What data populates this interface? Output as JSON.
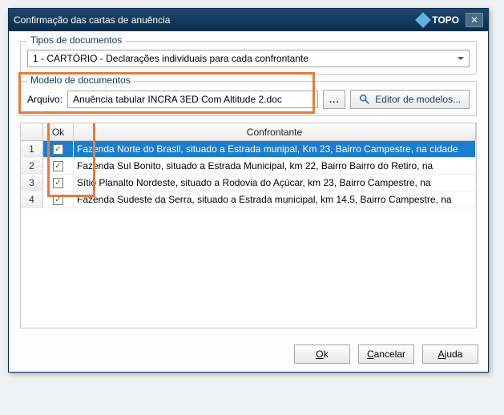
{
  "titlebar": {
    "title": "Confirmação das cartas de anuência",
    "logo": "TOPO",
    "close": "✕"
  },
  "tipos": {
    "legend": "Tipos de documentos",
    "selected": "1 - CARTÓRIO - Declarações individuais para cada confrontante"
  },
  "modelo": {
    "legend": "Modelo de documentos",
    "arquivo_label": "Arquivo:",
    "arquivo_value": "Anuência tabular INCRA 3ED Com Altitude 2.doc",
    "browse": "...",
    "editor": "Editor de modelos..."
  },
  "grid": {
    "headers": {
      "num": "",
      "ok": "Ok",
      "conf": "Confrontante"
    },
    "rows": [
      {
        "n": "1",
        "ok": true,
        "conf": "Fazenda Norte do Brasil, situado a Estrada munipal, Km 23, Bairro Campestre, na cidade",
        "sel": true
      },
      {
        "n": "2",
        "ok": true,
        "conf": "Fazenda Sul Bonito, situado a Estrada Municipal, km 22, Bairro Bairro do Retiro, na",
        "sel": false
      },
      {
        "n": "3",
        "ok": true,
        "conf": "Sítio Planalto Nordeste, situado a Rodovia do Açúcar, km 23, Bairro Campestre, na",
        "sel": false
      },
      {
        "n": "4",
        "ok": true,
        "conf": "Fazenda Sudeste da Serra, situado a Estrada municipal, km 14,5, Bairro Campestre, na",
        "sel": false
      }
    ]
  },
  "footer": {
    "ok": "Ok",
    "ok_u": "O",
    "cancel": "Cancelar",
    "cancel_u": "C",
    "help": "Ajuda",
    "help_u": "A"
  }
}
